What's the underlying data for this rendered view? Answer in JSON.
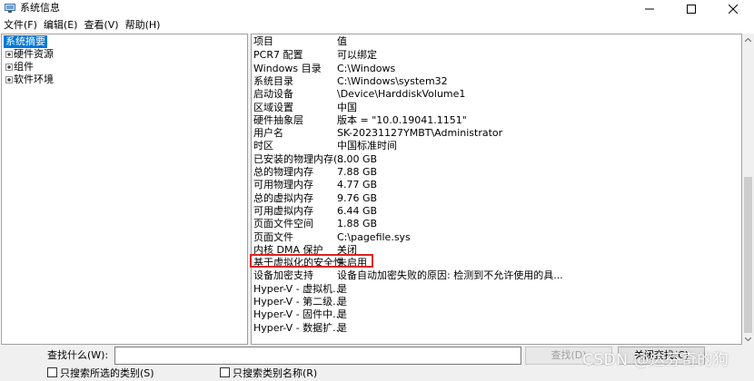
{
  "window": {
    "title": "系统信息"
  },
  "menubar": {
    "items": [
      "文件(F)",
      "编辑(E)",
      "查看(V)",
      "帮助(H)"
    ]
  },
  "tree": {
    "items": [
      {
        "label": "系统摘要",
        "selected": true,
        "expandable": false
      },
      {
        "label": "硬件资源",
        "selected": false,
        "expandable": true
      },
      {
        "label": "组件",
        "selected": false,
        "expandable": true
      },
      {
        "label": "软件环境",
        "selected": false,
        "expandable": true
      }
    ]
  },
  "list": {
    "header": {
      "item": "项目",
      "value": "值"
    },
    "rows": [
      {
        "item": "PCR7 配置",
        "value": "可以绑定"
      },
      {
        "item": "Windows 目录",
        "value": "C:\\Windows"
      },
      {
        "item": "系统目录",
        "value": "C:\\Windows\\system32"
      },
      {
        "item": "启动设备",
        "value": "\\Device\\HarddiskVolume1"
      },
      {
        "item": "区域设置",
        "value": "中国"
      },
      {
        "item": "硬件抽象层",
        "value": "版本 = \"10.0.19041.1151\""
      },
      {
        "item": "用户名",
        "value": "SK-20231127YMBT\\Administrator"
      },
      {
        "item": "时区",
        "value": "中国标准时间"
      },
      {
        "item": "已安装的物理内存(...",
        "value": "8.00 GB"
      },
      {
        "item": "总的物理内存",
        "value": "7.88 GB"
      },
      {
        "item": "可用物理内存",
        "value": "4.77 GB"
      },
      {
        "item": "总的虚拟内存",
        "value": "9.76 GB"
      },
      {
        "item": "可用虚拟内存",
        "value": "6.44 GB"
      },
      {
        "item": "页面文件空间",
        "value": "1.88 GB"
      },
      {
        "item": "页面文件",
        "value": "C:\\pagefile.sys"
      },
      {
        "item": "内核 DMA 保护",
        "value": "关闭"
      },
      {
        "item": "基于虚拟化的安全性",
        "value": "未启用"
      },
      {
        "item": "设备加密支持",
        "value": "设备自动加密失败的原因: 检测到不允许使用的具..."
      },
      {
        "item": "Hyper-V - 虚拟机...",
        "value": "是"
      },
      {
        "item": "Hyper-V - 第二级...",
        "value": "是"
      },
      {
        "item": "Hyper-V - 固件中...",
        "value": "是"
      },
      {
        "item": "Hyper-V - 数据扩...",
        "value": "是"
      }
    ]
  },
  "findbar": {
    "find_label": "查找什么(W):",
    "find_value": "",
    "find_button": "查找(D)",
    "close_find_button": "关闭查找(C)",
    "only_selected_category": "只搜索所选的类别(S)",
    "only_category_names": "只搜索类别名称(R)"
  },
  "watermark": "CSDN @达芬奇的狗",
  "colors": {
    "selection": "#0078d7",
    "highlight_border": "#e02020"
  }
}
